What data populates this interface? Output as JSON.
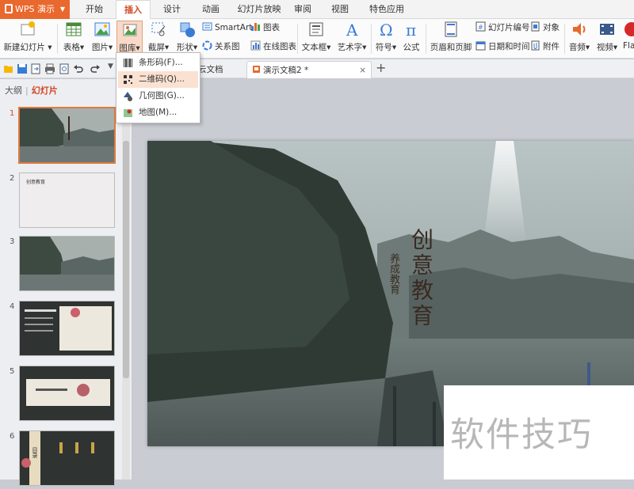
{
  "app": {
    "name": "WPS 演示"
  },
  "menu_tabs": [
    "开始",
    "插入",
    "设计",
    "动画",
    "幻灯片放映",
    "审阅",
    "视图",
    "特色应用"
  ],
  "active_menu_tab": "插入",
  "ribbon": {
    "new_slide": "新建幻灯片",
    "table": "表格",
    "image": "图片",
    "gallery": "图库",
    "screenshot": "截屏",
    "shapes": "形状",
    "smartart": "SmartArt",
    "relationship": "关系图",
    "chart": "图表",
    "online_chart": "在线图表",
    "textbox": "文本框",
    "wordart": "艺术字",
    "symbol": "符号",
    "formula": "公式",
    "header_footer": "页眉和页脚",
    "slide_number": "幻灯片编号",
    "datetime": "日期和时间",
    "object": "对象",
    "attachment": "附件",
    "audio": "音频",
    "video": "视频",
    "flash": "Fla"
  },
  "doc_tabs": [
    {
      "label": "云文档",
      "active": false
    },
    {
      "label": "演示文稿2 *",
      "active": true
    }
  ],
  "panel_tabs": {
    "outline": "大纲",
    "slides": "幻灯片"
  },
  "slides": [
    {
      "number": "1",
      "selected": true
    },
    {
      "number": "2",
      "selected": false,
      "text": "创意教育"
    },
    {
      "number": "3",
      "selected": false
    },
    {
      "number": "4",
      "selected": false
    },
    {
      "number": "5",
      "selected": false
    },
    {
      "number": "6",
      "selected": false,
      "text": "目录"
    }
  ],
  "slide_content": {
    "title": "创意教育",
    "subtitle": "养成教育"
  },
  "dropdown_menu": [
    {
      "label": "条形码(F)...",
      "icon": "barcode-icon",
      "highlighted": false
    },
    {
      "label": "二维码(Q)...",
      "icon": "qrcode-icon",
      "highlighted": true
    },
    {
      "label": "几何图(G)...",
      "icon": "geometry-icon",
      "highlighted": false
    },
    {
      "label": "地图(M)...",
      "icon": "map-icon",
      "highlighted": false
    }
  ],
  "watermark": "软件技巧",
  "colors": {
    "accent": "#d24726",
    "app_button": "#e9682e",
    "highlight": "#fbe1d1"
  }
}
